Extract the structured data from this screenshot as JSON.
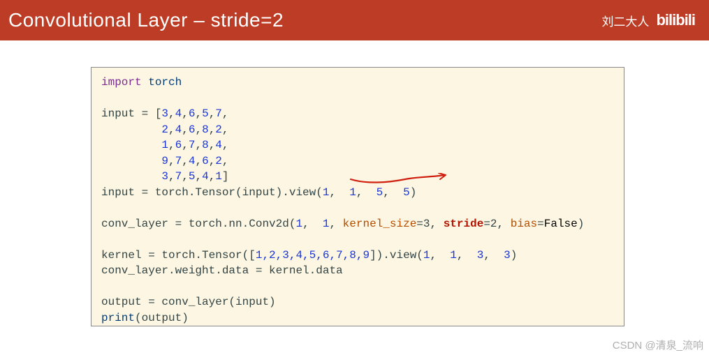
{
  "header": {
    "title": "Convolutional Layer – stride=2",
    "author": "刘二大人",
    "logo": "bilibili"
  },
  "code": {
    "kw_import": "import",
    "mod_torch": "torch",
    "t_input_eq": "input = [",
    "n3": "3",
    "n4": "4",
    "n6": "6",
    "n5": "5",
    "n7": "7",
    "n2": "2",
    "n8": "8",
    "n1": "1",
    "n9": "9",
    "t_brclose": "]",
    "t_input2_a": "input = torch.Tensor(input).view(",
    "v1": "1",
    "v1b": " 1",
    "v5": " 5",
    "v5b": " 5",
    "t_close_paren": ")",
    "t_conv_a": "conv_layer = torch.nn.Conv2d(",
    "c1": "1",
    "c1b": " 1",
    "arg_ks": "kernel_size",
    "eq3": "=3",
    "stride_word": "stride",
    "eq2": "=2",
    "arg_bias": "bias",
    "eq": "=",
    "false": "False",
    "t_kernel_a": "kernel = torch.Tensor([",
    "seq": "1,2,3,4,5,6,7,8,9",
    "t_kernel_b": "]).view(",
    "k1": "1",
    "k1b": " 1",
    "k3": " 3",
    "k3b": " 3",
    "t_weight": "conv_layer.weight.data = kernel.data",
    "t_output": "output = conv_layer(input)",
    "t_print_a": "print",
    "t_print_b": "(output)"
  },
  "watermark": "CSDN @清泉_流响"
}
